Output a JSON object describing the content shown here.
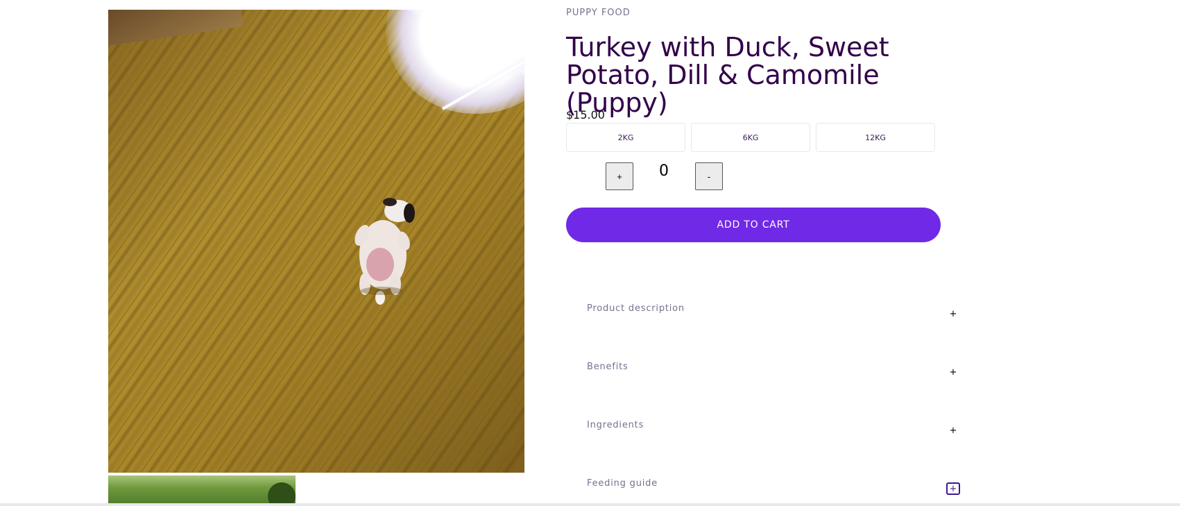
{
  "product": {
    "category": "PUPPY FOOD",
    "title": "Turkey with Duck, Sweet Potato, Dill & Camomile (Puppy)",
    "price": "$15.00",
    "main_image_alt": "Puppy lying on its back on a wooden floor",
    "thumb_image_alt": "Product thumbnail"
  },
  "variants": [
    {
      "label": "2KG"
    },
    {
      "label": "6KG"
    },
    {
      "label": "12KG"
    }
  ],
  "quantity": {
    "plus_label": "+",
    "value": "0",
    "minus_label": "-"
  },
  "cart": {
    "add_label": "ADD TO CART"
  },
  "accordion": [
    {
      "label": "Product description",
      "toggle": "+"
    },
    {
      "label": "Benefits",
      "toggle": "+"
    },
    {
      "label": "Ingredients",
      "toggle": "+"
    },
    {
      "label": "Feeding guide",
      "toggle": "+"
    }
  ],
  "colors": {
    "accent": "#7029e6",
    "title": "#32004a",
    "muted": "#7a6f90"
  }
}
